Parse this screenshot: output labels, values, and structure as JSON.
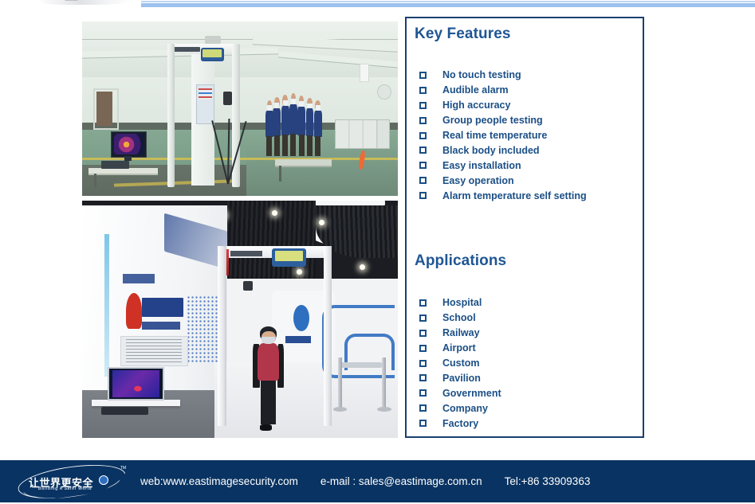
{
  "page": {
    "top_band_color": "#9dc0ee",
    "panel_border_color": "#1a3f6e",
    "heading_color": "#1f5694",
    "list_text_color": "#1b4f86",
    "footer_bg_color": "#093362"
  },
  "photos": [
    {
      "name": "factory-screening-hall",
      "caption": "Walk-through metal detector with thermal temperature screening in a factory hall; a group of masked workers queues at the right and a thermal monitor sits on a desk at the left."
    },
    {
      "name": "showroom-screening",
      "caption": "Showroom installation of the walk-through detector; a visitor in a red hoodie and mask walks through the gate while a thermal imaging monitor displays on a desk at the left."
    }
  ],
  "panel": {
    "key_features": {
      "heading": "Key Features",
      "items": [
        "No touch testing",
        "Audible alarm",
        "High accuracy",
        "Group people testing",
        "Real time temperature",
        "Black body included",
        "Easy installation",
        "Easy operation",
        "Alarm temperature self setting"
      ]
    },
    "applications": {
      "heading": "Applications",
      "items": [
        "Hospital",
        "School",
        "Railway",
        "Airport",
        "Custom",
        "Pavilion",
        "Government",
        "Company",
        "Factory"
      ]
    }
  },
  "footer": {
    "logo": {
      "chinese_slogan": "让世界更安全",
      "english_slogan": "Building A Safer World",
      "trademark": "TM"
    },
    "web": "web:www.eastimagesecurity.com",
    "email": "e-mail : sales@eastimage.com.cn",
    "tel": "Tel:+86 33909363"
  }
}
